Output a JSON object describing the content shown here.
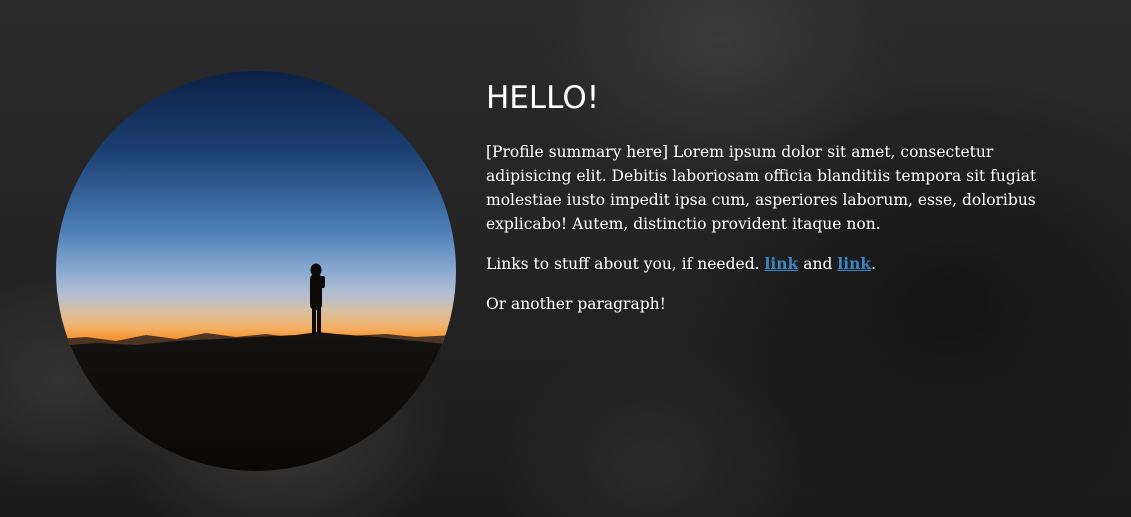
{
  "hero": {
    "title": "HELLO!",
    "summary": "[Profile summary here] Lorem ipsum dolor sit amet, consectetur adipisicing elit. Debitis laboriosam officia blanditiis tempora sit fugiat molestiae iusto impedit ipsa cum, asperiores laborum, esse, doloribus explicabo! Autem, distinctio provident itaque non.",
    "links_intro": "Links to stuff about you, if needed.",
    "link_1": "link",
    "links_conjunction": "and",
    "link_2": "link",
    "links_end": ".",
    "another_paragraph": "Or another paragraph!"
  },
  "colors": {
    "link": "#3a86c6",
    "text": "#ffffff"
  }
}
